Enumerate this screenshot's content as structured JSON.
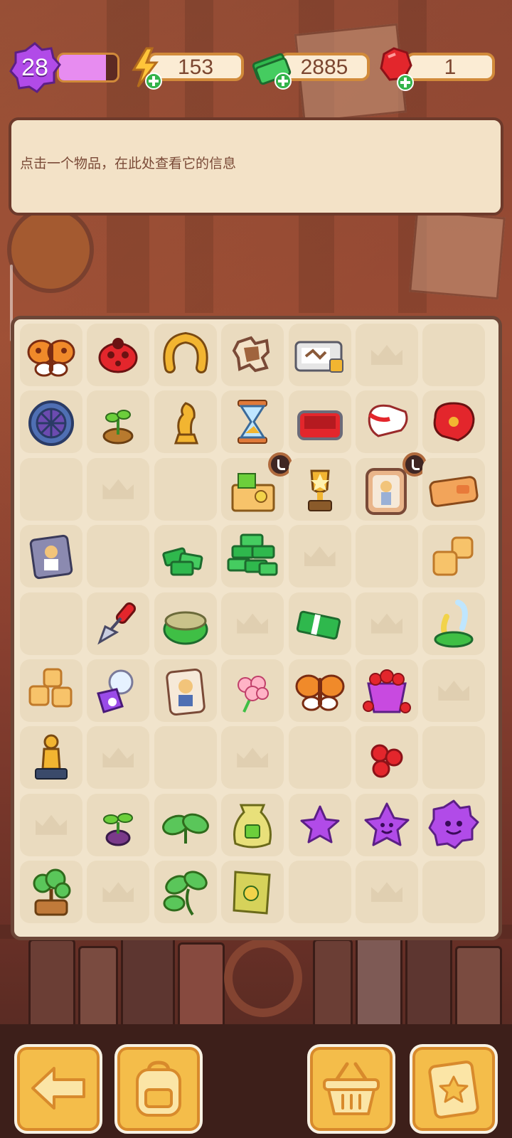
{
  "hud": {
    "level": "28",
    "level_progress": 0.8,
    "energy": "153",
    "cash": "2885",
    "gems": "1"
  },
  "info": {
    "message": "点击一个物品，在此处查看它的信息"
  },
  "board": {
    "columns": 7,
    "rows": 9,
    "cells": [
      [
        "butterfly-orange-pair",
        "ladybug-red",
        "horseshoe-gold",
        "leaf-stencil",
        "stamp-box-lv2",
        "empty-slot",
        "empty-blank"
      ],
      [
        "dial-wheel-blue",
        "sprout-small",
        "chess-knight-gold",
        "hourglass",
        "red-tray-box",
        "glove-white-red",
        "glove-red-gold"
      ],
      [
        "empty-blank",
        "empty-slot",
        "empty-blank",
        "surprise-crate-timer",
        "trophy-star-gold",
        "portrait-frame-timer",
        "orange-wallet"
      ],
      [
        "photo-card",
        "empty-blank",
        "cash-pile-medium",
        "cash-pile-large",
        "empty-slot",
        "empty-blank",
        "tofu-cubes-two"
      ],
      [
        "empty-blank",
        "trowel-red",
        "moss-rock",
        "empty-slot",
        "cash-stack-small",
        "empty-slot",
        "tuning-fork-green"
      ],
      [
        "tofu-cubes-three",
        "crystal-ball-purple",
        "badge-card",
        "pink-flower",
        "butterfly-orange",
        "gem-basket-red",
        "empty-slot"
      ],
      [
        "statue-gold",
        "empty-slot",
        "empty-blank",
        "empty-slot",
        "empty-blank",
        "gems-red-cluster",
        "empty-blank"
      ],
      [
        "empty-slot",
        "sprout-pot-small",
        "sprout-leaves",
        "seed-sack-large",
        "star-purple-small",
        "star-purple-smile",
        "star-purple-big"
      ],
      [
        "bonsai-pot",
        "empty-slot",
        "sprout-leaves-large",
        "seed-packet",
        "empty-blank",
        "empty-slot",
        "empty-blank"
      ]
    ]
  },
  "buttons": {
    "back": "back-arrow-icon",
    "backpack": "backpack-icon",
    "shop": "basket-icon",
    "tasks": "clipboard-star-icon"
  },
  "colors": {
    "accent": "#f4bd4a",
    "panel": "#f3e2c7",
    "board": "#f1e4cc",
    "cash": "#2fb84d",
    "gem": "#e3262c",
    "level": "#b14be8"
  }
}
